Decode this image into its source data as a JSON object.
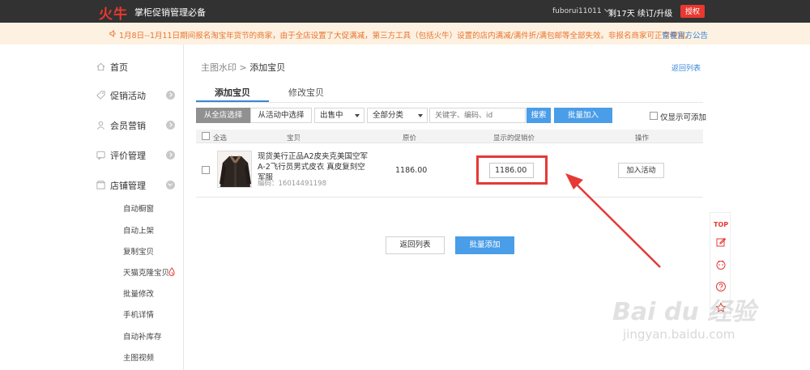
{
  "topbar": {
    "logo": "火牛",
    "slogan": "掌柜促销管理必备",
    "user": "fuborui11011",
    "remaining": "剩17天 续订/升级",
    "auth": "授权"
  },
  "notice": {
    "text": "1月8日--1月11日期间报名淘宝年货节的商家，由于全店设置了大促满减，第三方工具（包括火牛）设置的店内满减/满件折/满包邮等全部失效。非报名商家可正常使用。",
    "link": "查看官方公告"
  },
  "sidebar": {
    "items": [
      {
        "label": "首页",
        "icon": "home-icon"
      },
      {
        "label": "促销活动",
        "icon": "tag-icon"
      },
      {
        "label": "会员营销",
        "icon": "member-icon"
      },
      {
        "label": "评价管理",
        "icon": "review-icon"
      },
      {
        "label": "店铺管理",
        "icon": "store-icon"
      }
    ],
    "sub": [
      "自动橱窗",
      "自动上架",
      "复制宝贝",
      "天猫克隆宝贝",
      "批量修改",
      "手机详情",
      "自动补库存",
      "主图视频"
    ]
  },
  "main": {
    "breadcrumb_parent": "主图水印",
    "breadcrumb_sep": ">",
    "breadcrumb_current": "添加宝贝",
    "back_link": "返回列表",
    "tabs": [
      "添加宝贝",
      "修改宝贝"
    ],
    "filters": {
      "from_store": "从全店选择",
      "from_activity": "从活动中选择",
      "status": "出售中",
      "category": "全部分类",
      "search_placeholder": "关键字、编码、id",
      "search": "搜索",
      "bulk_add": "批量加入",
      "only_addable": "仅显示可添加"
    },
    "table": {
      "headers": [
        "全选",
        "宝贝",
        "原价",
        "显示的促销价",
        "操作"
      ],
      "rows": [
        {
          "title": "现货美行正品A2皮夹克美国空军A-2飞行员男式皮衣 真皮复刻空军服",
          "code": "编码：16014491198",
          "price": "1186.00",
          "promo": "1186.00",
          "action": "加入活动"
        }
      ]
    },
    "bottom_back": "返回列表",
    "bottom_bulk": "批量添加"
  },
  "float_bar": {
    "top": "TOP"
  },
  "watermark": {
    "main": "Bai du 经验",
    "sub": "jingyan.baidu.com"
  },
  "colors": {
    "accent": "#4a9de8",
    "brand": "#e8382f",
    "highlight": "#e53935"
  }
}
